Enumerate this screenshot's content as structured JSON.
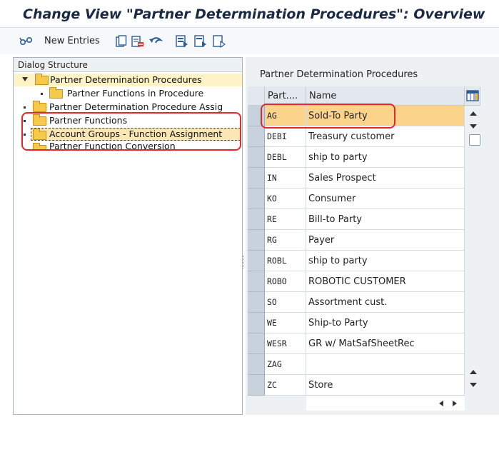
{
  "window": {
    "title": "Change View \"Partner Determination Procedures\": Overview"
  },
  "toolbar": {
    "new_entries_label": "New Entries"
  },
  "dialog_structure": {
    "header": "Dialog Structure",
    "items": [
      {
        "label": "Partner Determination Procedures"
      },
      {
        "label": "Partner Functions in Procedure"
      },
      {
        "label": "Partner Determination Procedure Assig"
      },
      {
        "label": "Partner Functions"
      },
      {
        "label": "Account Groups - Function Assignment"
      },
      {
        "label": "Partner Function Conversion"
      }
    ]
  },
  "table": {
    "title": "Partner Determination Procedures",
    "columns": [
      "Part....",
      "Name"
    ],
    "rows": [
      {
        "code": "AG",
        "name": "Sold-To Party"
      },
      {
        "code": "DEBI",
        "name": "Treasury customer"
      },
      {
        "code": "DEBL",
        "name": "ship to party"
      },
      {
        "code": "IN",
        "name": "Sales Prospect"
      },
      {
        "code": "KO",
        "name": "Consumer"
      },
      {
        "code": "RE",
        "name": "Bill-to Party"
      },
      {
        "code": "RG",
        "name": "Payer"
      },
      {
        "code": "ROBL",
        "name": "ship to party"
      },
      {
        "code": "ROBO",
        "name": "ROBOTIC CUSTOMER"
      },
      {
        "code": "SO",
        "name": "Assortment cust."
      },
      {
        "code": "WE",
        "name": "Ship-to Party"
      },
      {
        "code": "WESR",
        "name": "GR w/ MatSafSheetRec"
      },
      {
        "code": "ZAG",
        "name": ""
      },
      {
        "code": "ZC",
        "name": "Store"
      }
    ]
  },
  "colors": {
    "title_text": "#1a2a45",
    "selected_row": "#fbd38a",
    "folder_yellow": "#f7c94a",
    "red_annotation": "#e3282b",
    "panel_bg": "#eef1f4"
  },
  "icons": [
    "change-display-icon",
    "copy-icon",
    "delete-icon",
    "undo-icon",
    "select-all-icon",
    "select-block-icon",
    "deselect-all-icon",
    "column-settings-icon"
  ]
}
